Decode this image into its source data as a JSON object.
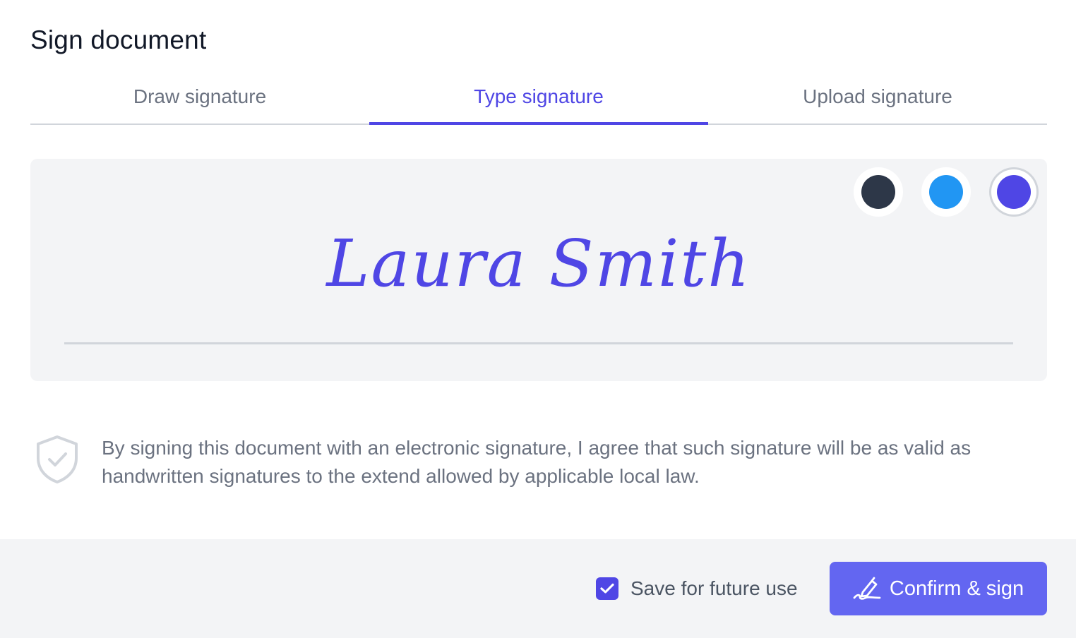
{
  "dialog": {
    "title": "Sign document"
  },
  "tabs": [
    {
      "label": "Draw signature",
      "active": false
    },
    {
      "label": "Type signature",
      "active": true
    },
    {
      "label": "Upload signature",
      "active": false
    }
  ],
  "signature": {
    "text": "Laura Smith",
    "colors": [
      {
        "name": "dark",
        "hex": "#2d3748",
        "selected": false
      },
      {
        "name": "blue",
        "hex": "#2196f3",
        "selected": false
      },
      {
        "name": "indigo",
        "hex": "#4f46e5",
        "selected": true
      }
    ]
  },
  "legal": {
    "icon": "shield-check-icon",
    "text": "By signing this document with an electronic signature, I agree that such signature will be as valid as handwritten signatures to the extend allowed by applicable local law."
  },
  "footer": {
    "save_label": "Save for future use",
    "save_checked": true,
    "confirm_label": "Confirm & sign",
    "confirm_icon": "pen-sign-icon"
  },
  "theme": {
    "accent": "#4f46e5",
    "button": "#6366f1",
    "muted_text": "#6b7280",
    "panel_bg": "#f3f4f6"
  }
}
